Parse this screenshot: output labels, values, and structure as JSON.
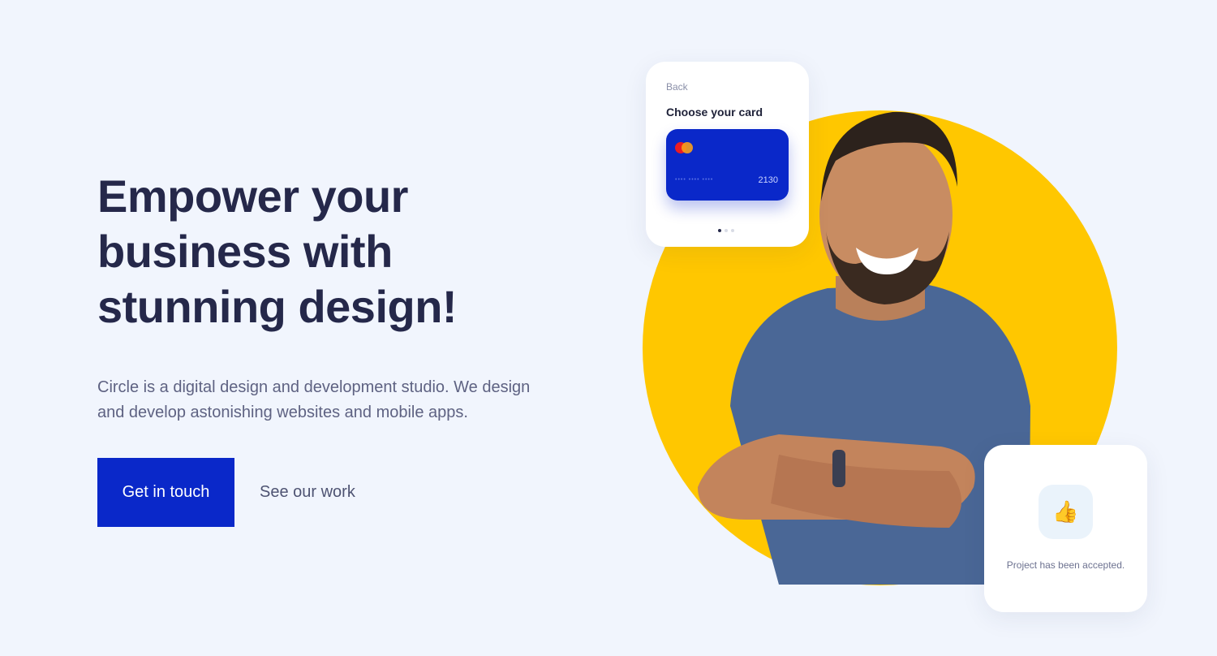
{
  "hero": {
    "headline_lines": [
      "Empower your",
      "business with",
      "stunning design!"
    ],
    "description": "Circle is a digital design and development studio. We design and develop astonishing websites and mobile apps.",
    "primary_cta": "Get in touch",
    "secondary_cta": "See our work"
  },
  "card_widget": {
    "back_label": "Back",
    "title": "Choose your card",
    "card_masked": "•••• •••• ••••",
    "card_last_digits": "2130",
    "pager_total": 3,
    "pager_active": 1
  },
  "accept_widget": {
    "icon_glyph": "👍",
    "message": "Project has been accepted."
  },
  "colors": {
    "background": "#f1f5fd",
    "primary": "#0a28c9",
    "accent_yellow": "#ffc700",
    "heading": "#25284a"
  }
}
